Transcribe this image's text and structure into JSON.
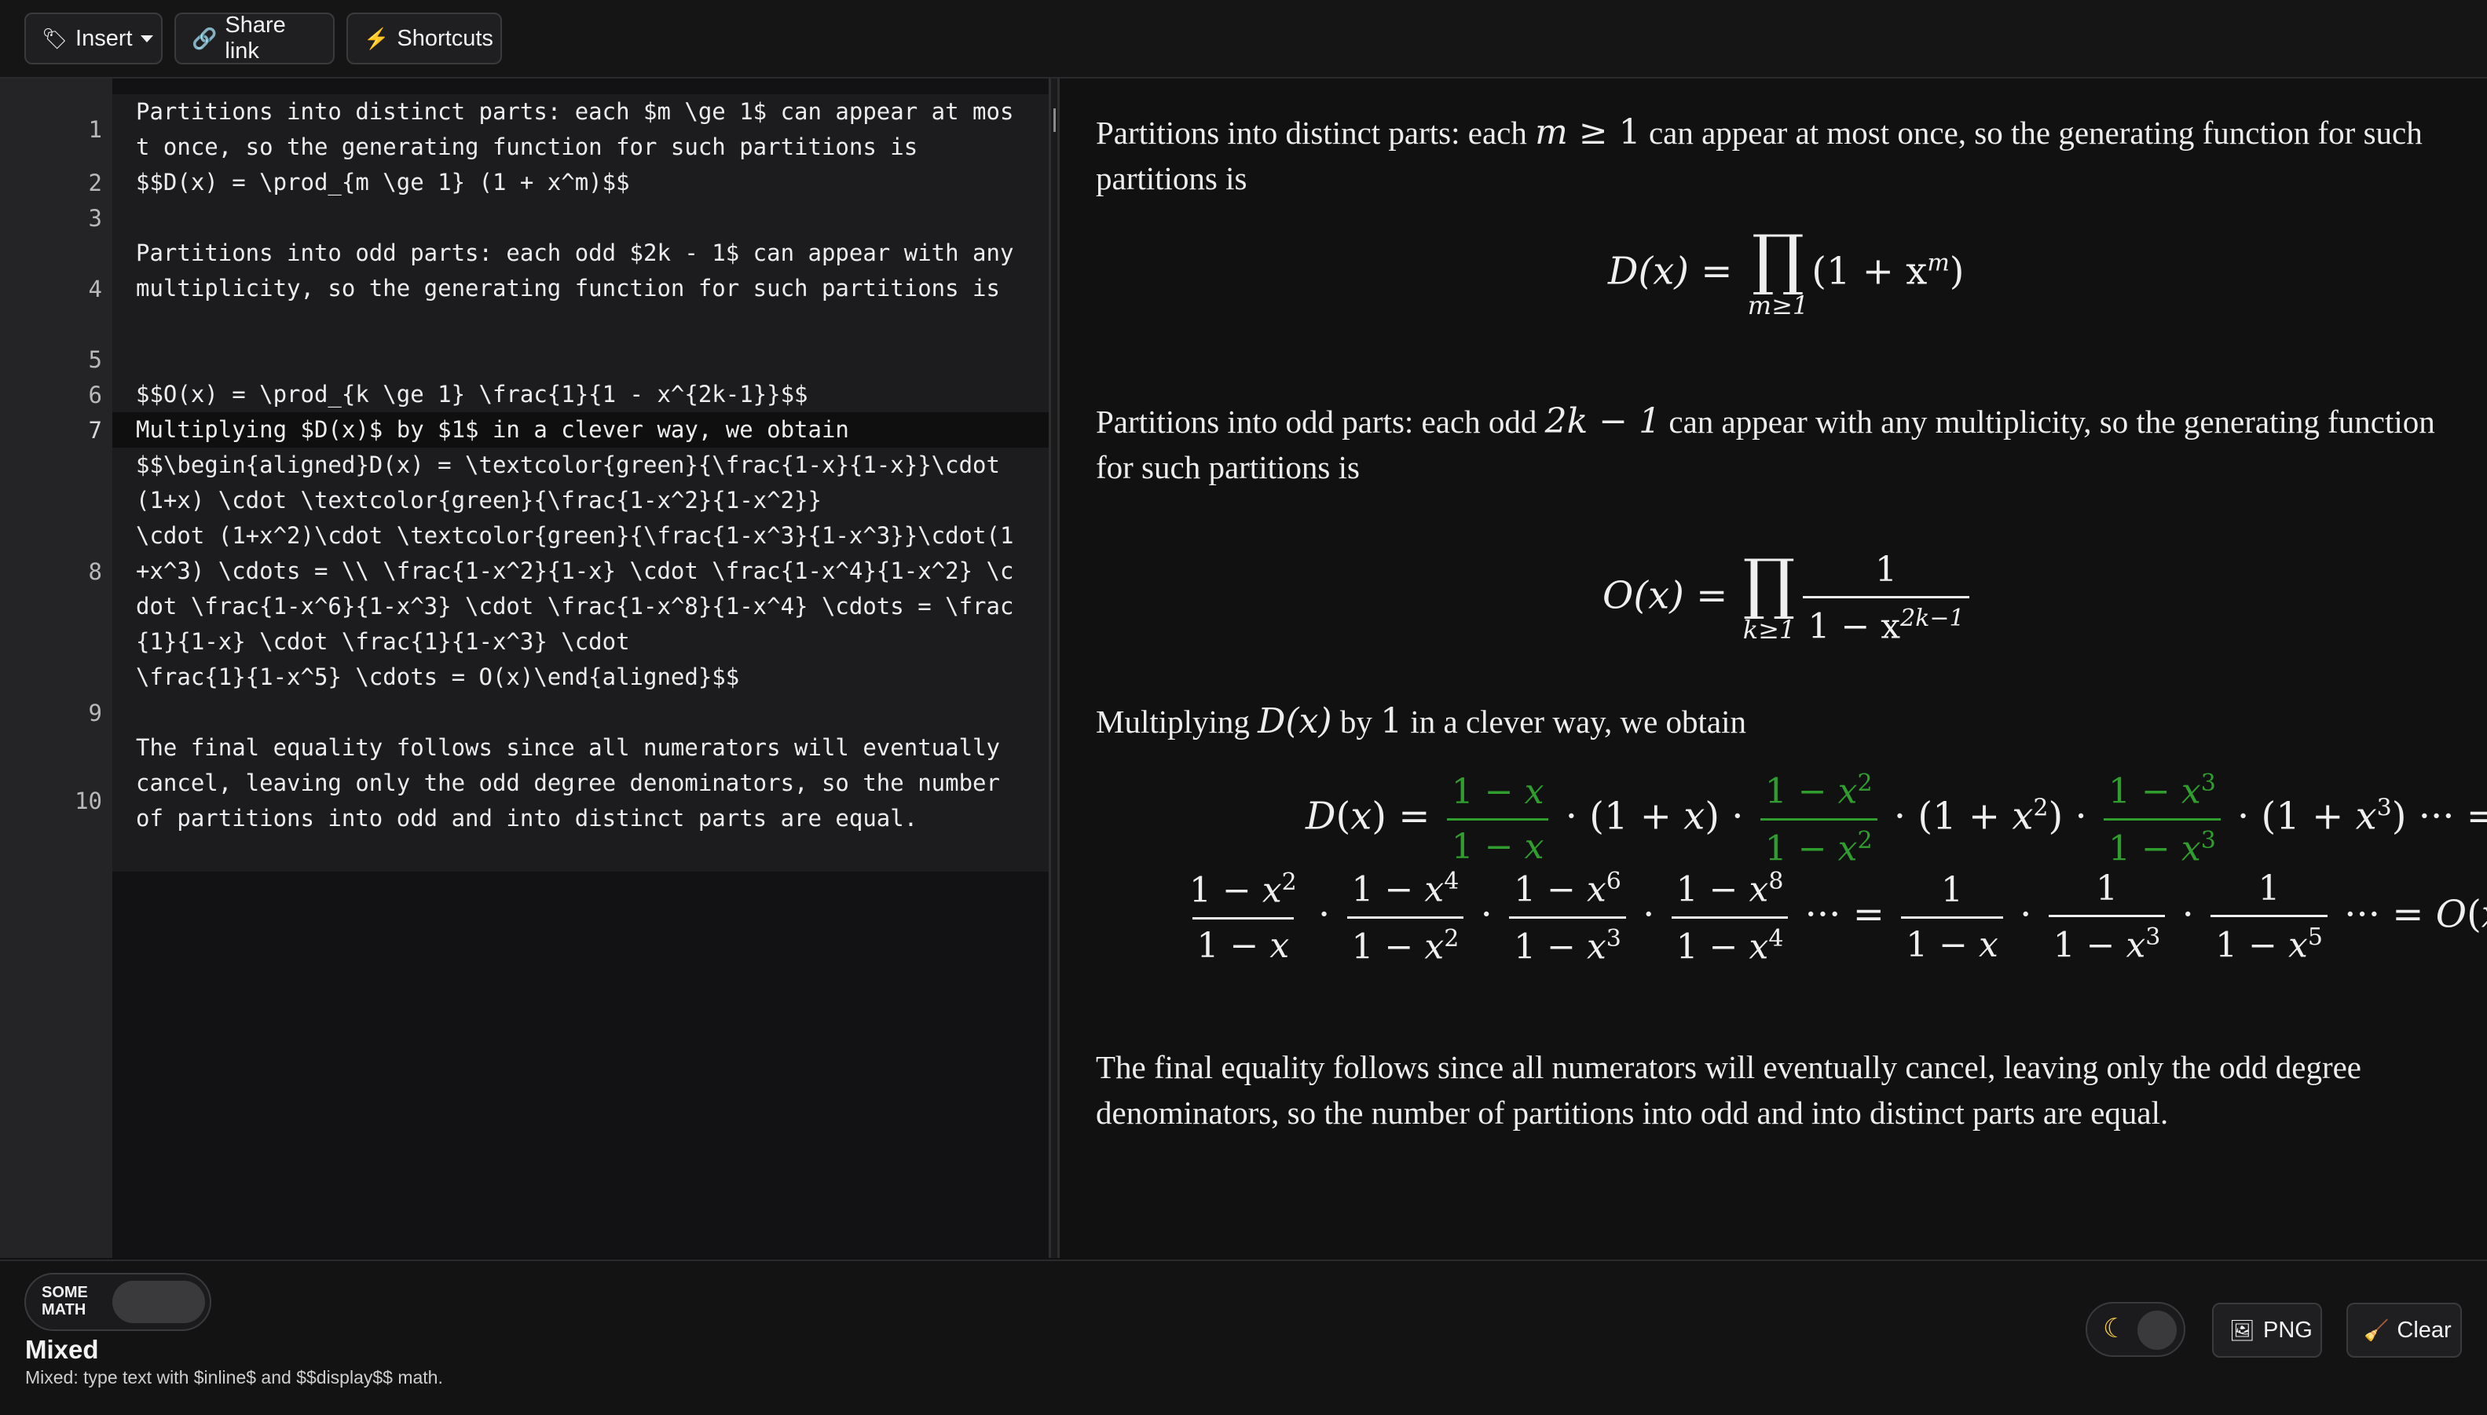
{
  "toolbar": {
    "insert_label": "Insert",
    "insert_icon": "tag-icon",
    "share_label": "Share link",
    "share_icon": "link-icon",
    "shortcuts_label": "Shortcuts",
    "shortcuts_icon": "lightning-icon"
  },
  "editor": {
    "lines": [
      {
        "num": "1",
        "text": "Partitions into distinct parts: each $m \\ge 1$ can appear at most once, so the generating function for such partitions is"
      },
      {
        "num": "2",
        "text": "$$D(x) = \\prod_{m \\ge 1} (1 + x^m)$$"
      },
      {
        "num": "3",
        "text": ""
      },
      {
        "num": "4",
        "text": "Partitions into odd parts: each odd $2k - 1$ can appear with any multiplicity, so the generating function for such partitions is"
      },
      {
        "num": "5",
        "text": ""
      },
      {
        "num": "6",
        "text": "$$O(x) = \\prod_{k \\ge 1} \\frac{1}{1 - x^{2k-1}}$$"
      },
      {
        "num": "7",
        "text": "Multiplying $D(x)$ by $1$ in a clever way, we obtain"
      },
      {
        "num": "8",
        "text": "$$\\begin{aligned}D(x) = \\textcolor{green}{\\frac{1-x}{1-x}}\\cdot (1+x) \\cdot \\textcolor{green}{\\frac{1-x^2}{1-x^2}}\n\\cdot (1+x^2)\\cdot \\textcolor{green}{\\frac{1-x^3}{1-x^3}}\\cdot(1+x^3) \\cdots = \\\\ \\frac{1-x^2}{1-x} \\cdot \\frac{1-x^4}{1-x^2} \\cdot \\frac{1-x^6}{1-x^3} \\cdot \\frac{1-x^8}{1-x^4} \\cdots = \\frac{1}{1-x} \\cdot \\frac{1}{1-x^3} \\cdot\n\\frac{1}{1-x^5} \\cdots = O(x)\\end{aligned}$$"
      },
      {
        "num": "9",
        "text": ""
      },
      {
        "num": "10",
        "text": "The final equality follows since all numerators will eventually cancel, leaving only the odd degree denominators, so the number of partitions into odd and into distinct parts are equal."
      }
    ]
  },
  "preview": {
    "p1_a": "Partitions into distinct parts: each ",
    "p1_m": "m",
    "p1_b": " ≥ 1",
    "p1_c": " can appear at most once, so the generating function for such partitions is",
    "eq1_lhs": "D(x) = ",
    "eq1_sub": "m≥1",
    "eq1_rhs": "(1 + x",
    "eq1_sup": "m",
    "eq1_end": ")",
    "p2_a": "Partitions into odd parts: each odd ",
    "p2_m": "2k − 1",
    "p2_c": " can appear with any multiplicity, so the generating function for such partitions is",
    "eq2_lhs": "O(x) = ",
    "eq2_sub": "k≥1",
    "eq2_num": "1",
    "eq2_den": "1 − x",
    "eq2_sup": "2k−1",
    "p3_a": "Multiplying ",
    "p3_m1": "D(x)",
    "p3_b": " by ",
    "p3_m2": "1",
    "p3_c": " in a clever way, we obtain",
    "p4": "The final equality follows since all numerators will eventually cancel, leaving only the odd degree denominators, so the number of partitions into odd and into distinct parts are equal.",
    "green": "#2f9e2f"
  },
  "footer": {
    "mode_toggle_label": "SOME MATH",
    "mode_title": "Mixed",
    "mode_hint": "Mixed: type text with $inline$ and $$display$$ math.",
    "theme_icon": "moon-icon",
    "png_label": "PNG",
    "png_icon": "image-icon",
    "clear_label": "Clear",
    "clear_icon": "broom-icon"
  }
}
